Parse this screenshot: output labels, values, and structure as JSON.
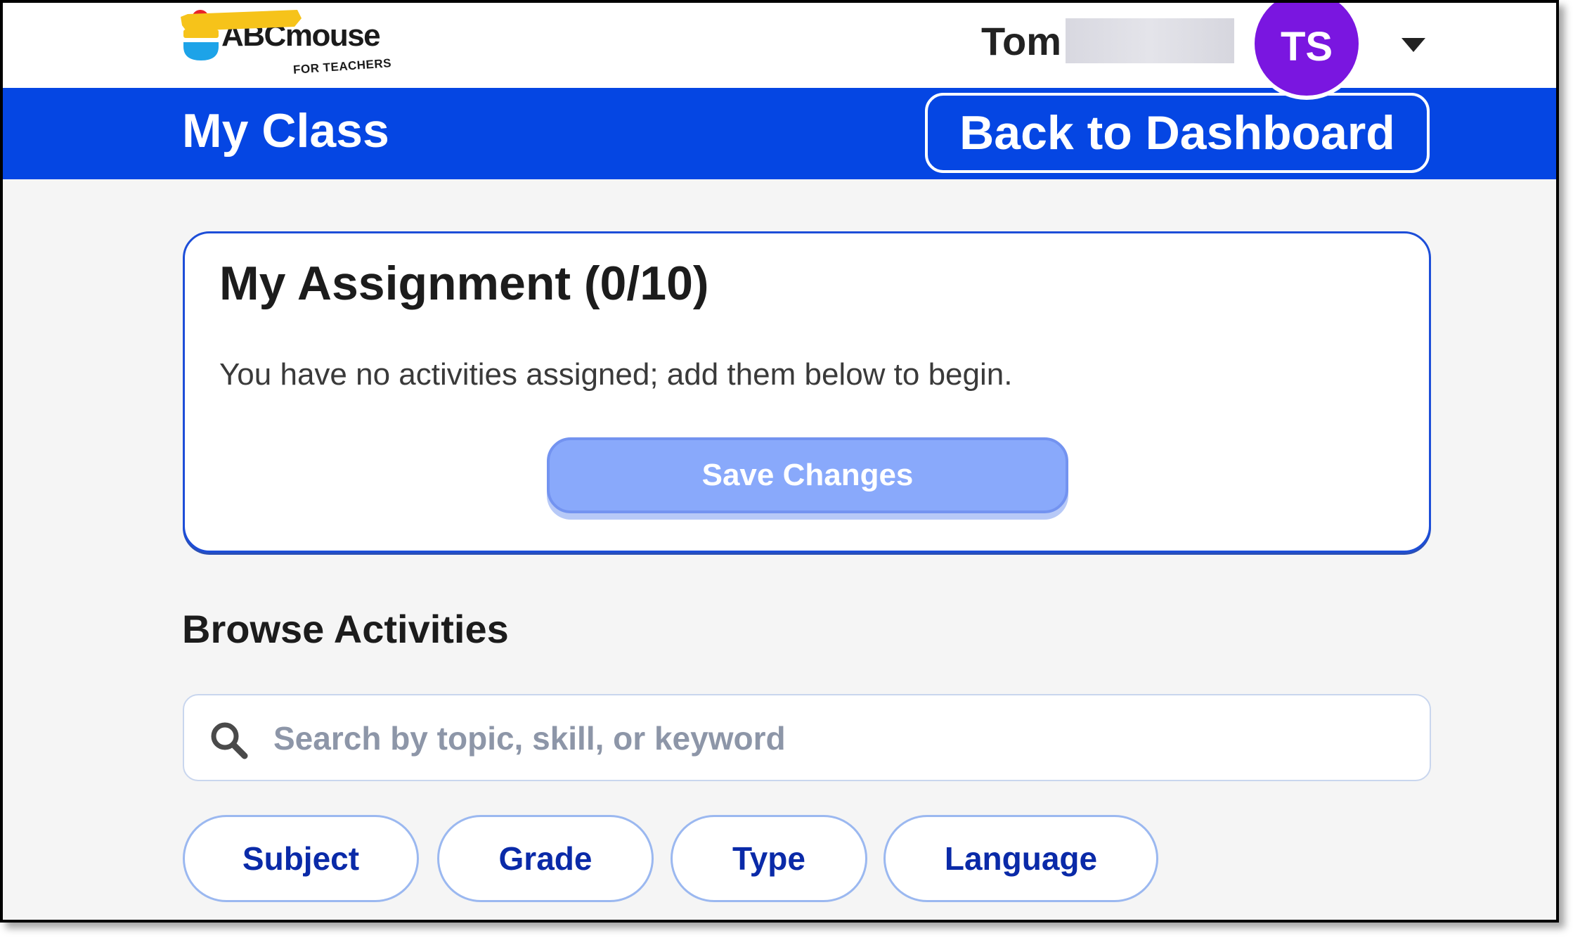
{
  "header": {
    "logo_text": "ABCmouse",
    "logo_ribbon": "FOR TEACHERS",
    "user_name": "Tom",
    "avatar_initials": "TS",
    "dropdown_icon": "caret-down-icon"
  },
  "titlebar": {
    "title": "My Class",
    "back_button": "Back to Dashboard",
    "color": "#0546e3"
  },
  "assignment": {
    "title": "My Assignment (0/10)",
    "message": "You have no activities assigned; add them below to begin.",
    "save_button": "Save Changes"
  },
  "browse": {
    "title": "Browse Activities",
    "search_placeholder": "Search by topic, skill, or keyword",
    "search_icon": "search-icon",
    "filters": [
      "Subject",
      "Grade",
      "Type",
      "Language"
    ]
  },
  "colors": {
    "accent": "#0546e3",
    "avatar": "#7a16e0",
    "save_button": "#89a9fb",
    "filter_text": "#0a2aa8"
  }
}
